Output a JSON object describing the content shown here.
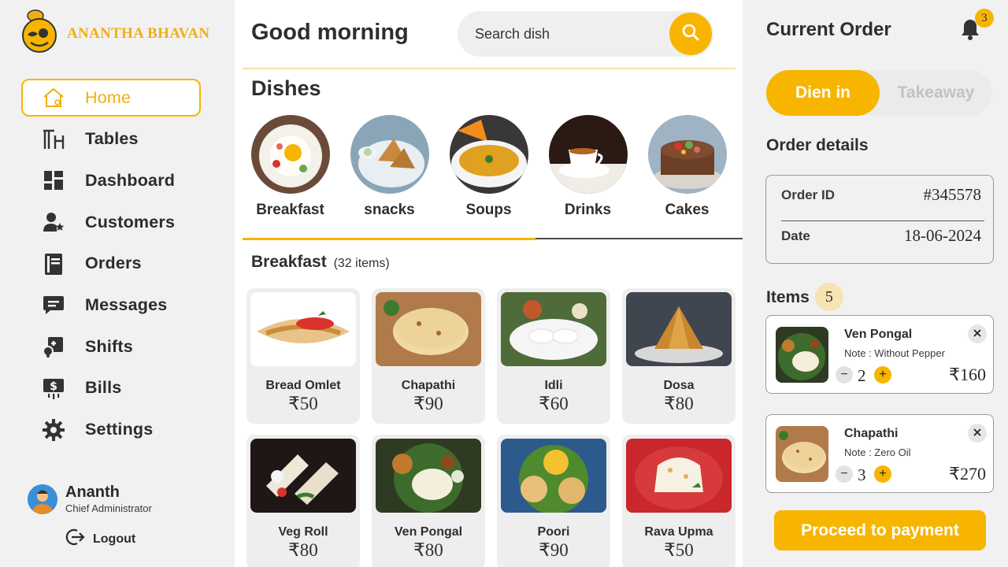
{
  "brand": {
    "name": "ANANTHA BHAVAN"
  },
  "sidebar": {
    "items": [
      {
        "label": "Home",
        "icon": "home-icon",
        "active": true
      },
      {
        "label": "Tables",
        "icon": "table-icon"
      },
      {
        "label": "Dashboard",
        "icon": "dashboard-icon"
      },
      {
        "label": "Customers",
        "icon": "customers-icon"
      },
      {
        "label": "Orders",
        "icon": "orders-icon"
      },
      {
        "label": "Messages",
        "icon": "message-icon"
      },
      {
        "label": "Shifts",
        "icon": "shifts-icon"
      },
      {
        "label": "Bills",
        "icon": "bills-icon"
      },
      {
        "label": "Settings",
        "icon": "gear-icon"
      }
    ]
  },
  "user": {
    "name": "Ananth",
    "role": "Chief Administrator",
    "logout_label": "Logout"
  },
  "header": {
    "greeting": "Good morning",
    "search_placeholder": "Search dish"
  },
  "dishes": {
    "title": "Dishes",
    "categories": [
      {
        "label": "Breakfast",
        "active": true
      },
      {
        "label": "snacks"
      },
      {
        "label": "Soups"
      },
      {
        "label": "Drinks"
      },
      {
        "label": "Cakes"
      }
    ]
  },
  "listing": {
    "title": "Breakfast",
    "count": "(32 items)",
    "items": [
      {
        "name": "Bread Omlet",
        "price": "₹50"
      },
      {
        "name": "Chapathi",
        "price": "₹90"
      },
      {
        "name": "Idli",
        "price": "₹60"
      },
      {
        "name": "Dosa",
        "price": "₹80"
      },
      {
        "name": "Veg Roll",
        "price": "₹80"
      },
      {
        "name": "Ven Pongal",
        "price": "₹80"
      },
      {
        "name": "Poori",
        "price": "₹90"
      },
      {
        "name": "Rava Upma",
        "price": "₹50"
      }
    ]
  },
  "order": {
    "title": "Current Order",
    "notification_count": "3",
    "mode_options": [
      "Dien in",
      "Takeaway"
    ],
    "selected_mode": "Dien in",
    "details_title": "Order details",
    "order_id_label": "Order ID",
    "order_id": "#345578",
    "date_label": "Date",
    "date": "18-06-2024",
    "items_label": "Items",
    "items_count": "5",
    "lines": [
      {
        "name": "Ven Pongal",
        "note": "Note : Without Pepper",
        "qty": "2",
        "price": "₹160"
      },
      {
        "name": "Chapathi",
        "note": "Note : Zero Oil",
        "qty": "3",
        "price": "₹270"
      }
    ],
    "pay_label": "Proceed to payment"
  },
  "colors": {
    "accent": "#f7b500",
    "brand_text": "#f2ae12",
    "sidebar_bg": "#f1f1f1",
    "card_bg": "#efeeee"
  }
}
